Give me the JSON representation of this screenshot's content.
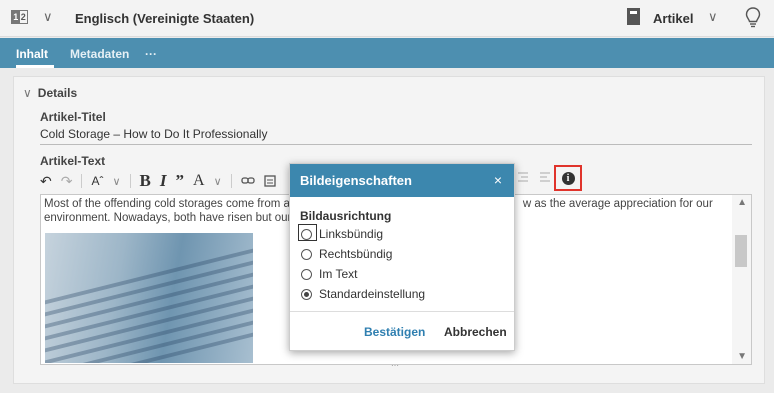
{
  "topbar": {
    "lang_icon_left": "1",
    "lang_icon_right": "2",
    "language": "Englisch (Vereinigte Staaten)",
    "doc_type": "Artikel",
    "chevron": "∨"
  },
  "tabs": [
    {
      "label": "Inhalt",
      "active": true
    },
    {
      "label": "Metadaten",
      "active": false
    },
    {
      "label": "···",
      "active": false
    }
  ],
  "details": {
    "header": "Details",
    "title_label": "Artikel-Titel",
    "title_value": "Cold Storage – How to Do It Professionally",
    "text_label": "Artikel-Text",
    "text_visible_left": "Most of the offending cold storages come from a",
    "text_visible_right": "w as the average appreciation for our",
    "text_line2_left": "environment. Nowadays, both have risen but our c"
  },
  "toolbar": {
    "undo": "↶",
    "redo": "↷",
    "font_size": "Aˆ",
    "bold": "B",
    "italic": "I",
    "quote": "”",
    "text_color": "A",
    "info": "i"
  },
  "dialog": {
    "title": "Bildeigenschaften",
    "close": "×",
    "section": "Bildausrichtung",
    "options": [
      {
        "label": "Linksbündig",
        "checked": false
      },
      {
        "label": "Rechtsbündig",
        "checked": false
      },
      {
        "label": "Im Text",
        "checked": false
      },
      {
        "label": "Standardeinstellung",
        "checked": true
      }
    ],
    "confirm_label": "Bestätigen",
    "cancel_label": "Abbrechen"
  },
  "colors": {
    "tab_bar": "#4d8fb0",
    "dialog_header": "#3c87ae",
    "highlight": "#e0332b"
  }
}
